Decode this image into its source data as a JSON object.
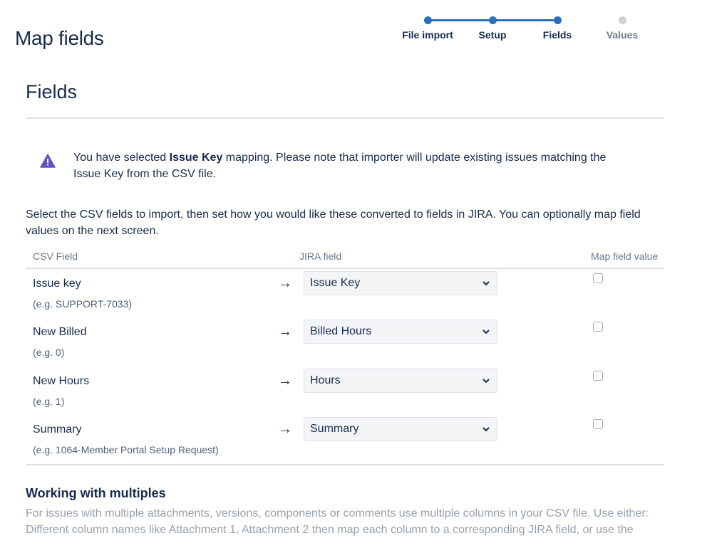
{
  "page": {
    "title": "Map fields"
  },
  "steps": [
    {
      "label": "File import",
      "status": "complete"
    },
    {
      "label": "Setup",
      "status": "complete"
    },
    {
      "label": "Fields",
      "status": "current"
    },
    {
      "label": "Values",
      "status": "pending"
    }
  ],
  "section": {
    "title": "Fields"
  },
  "warning": {
    "icon": "warning-icon",
    "prefix": "You have selected ",
    "bold": "Issue Key",
    "suffix": " mapping. Please note that importer will update existing issues matching the Issue Key from the CSV file."
  },
  "intro": "Select the CSV fields to import, then set how you would like these converted to fields in JIRA. You can optionally map field values on the next screen.",
  "table": {
    "headers": {
      "csv_field": "CSV Field",
      "jira_field": "JIRA field",
      "map_value": "Map field value"
    },
    "rows": [
      {
        "csv_field": "Issue key",
        "example": "(e.g.  SUPPORT-7033)",
        "jira_field": "Issue Key",
        "map_value": false
      },
      {
        "csv_field": "New Billed",
        "example": "(e.g.  0)",
        "jira_field": "Billed Hours",
        "map_value": false
      },
      {
        "csv_field": "New Hours",
        "example": "(e.g.  1)",
        "jira_field": "Hours",
        "map_value": false
      },
      {
        "csv_field": "Summary",
        "example": "(e.g.  1064-Member Portal Setup Request)",
        "jira_field": "Summary",
        "map_value": false
      }
    ]
  },
  "multiples": {
    "title": "Working with multiples",
    "text": "For issues with multiple attachments, versions, components or comments use multiple columns in your CSV file. Use either: Different column names like Attachment 1, Attachment 2 then map each column to a corresponding JIRA field, or use the"
  },
  "colors": {
    "accent": "#2a6ebb",
    "warning": "#6554c0",
    "text": "#172b4d",
    "muted": "#6b778c"
  }
}
